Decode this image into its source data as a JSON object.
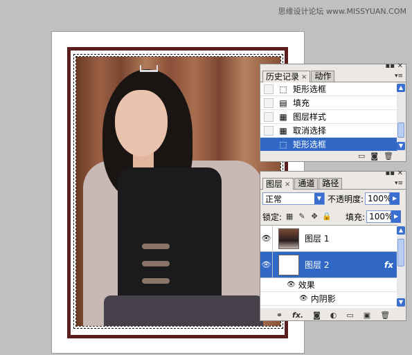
{
  "watermark": "思缘设计论坛 www.MISSYUAN.COM",
  "history_panel": {
    "tabs": [
      {
        "label": "历史记录",
        "close": "×"
      },
      {
        "label": "动作"
      }
    ],
    "items": [
      {
        "label": "矩形选框",
        "icon": "marquee-icon"
      },
      {
        "label": "填充",
        "icon": "fill-icon"
      },
      {
        "label": "图层样式",
        "icon": "layer-style-icon"
      },
      {
        "label": "取消选择",
        "icon": "deselect-icon"
      },
      {
        "label": "矩形选框",
        "icon": "marquee-icon",
        "selected": true
      }
    ]
  },
  "layers_panel": {
    "tabs": [
      {
        "label": "图层",
        "close": "×"
      },
      {
        "label": "通道"
      },
      {
        "label": "路径"
      }
    ],
    "blend_mode": "正常",
    "opacity_label": "不透明度:",
    "opacity_value": "100%",
    "lock_label": "锁定:",
    "fill_label": "填充:",
    "fill_value": "100%",
    "layers": [
      {
        "name": "图层 1",
        "selected": false
      },
      {
        "name": "图层 2",
        "selected": true,
        "fx": "fx"
      }
    ],
    "effects_label": "效果",
    "inner_shadow_label": "内阴影",
    "bottom_icons": [
      "link-icon",
      "fx-icon",
      "mask-icon",
      "adjustment-icon",
      "folder-icon",
      "new-layer-icon",
      "trash-icon"
    ],
    "fx_button": "fx."
  },
  "colors": {
    "selection": "#3168c6",
    "frame": "#5a1e1e"
  }
}
